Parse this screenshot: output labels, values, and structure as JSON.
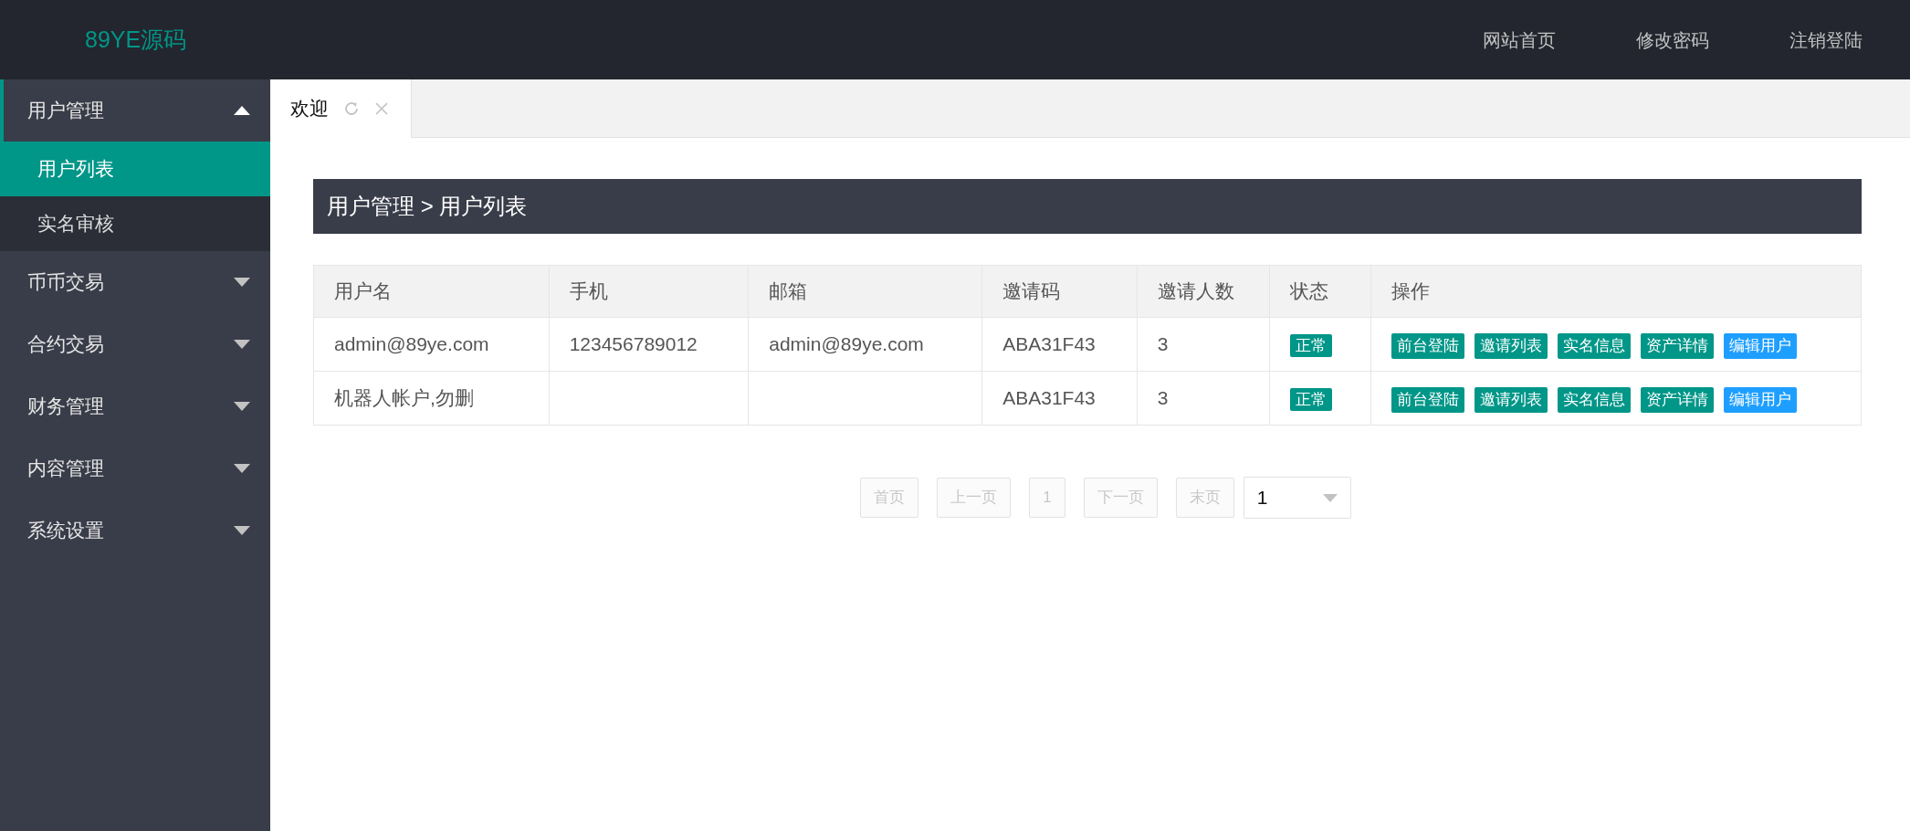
{
  "header": {
    "logo": "89YE源码",
    "links": [
      "网站首页",
      "修改密码",
      "注销登陆"
    ]
  },
  "sidebar": {
    "items": [
      {
        "label": "用户管理",
        "expanded": true,
        "children": [
          {
            "label": "用户列表",
            "selected": true
          },
          {
            "label": "实名审核",
            "selected": false
          }
        ]
      },
      {
        "label": "币币交易",
        "expanded": false
      },
      {
        "label": "合约交易",
        "expanded": false
      },
      {
        "label": "财务管理",
        "expanded": false
      },
      {
        "label": "内容管理",
        "expanded": false
      },
      {
        "label": "系统设置",
        "expanded": false
      }
    ]
  },
  "tabs": [
    {
      "label": "欢迎",
      "selected": true
    }
  ],
  "breadcrumb": "用户管理 > 用户列表",
  "table": {
    "columns": [
      "用户名",
      "手机",
      "邮箱",
      "邀请码",
      "邀请人数",
      "状态",
      "操作"
    ],
    "rows": [
      {
        "username": "admin@89ye.com",
        "phone": "123456789012",
        "email": "admin@89ye.com",
        "invite_code": "ABA31F43",
        "invites": "3",
        "status": "正常",
        "actions": [
          {
            "label": "前台登陆",
            "kind": "normal"
          },
          {
            "label": "邀请列表",
            "kind": "normal"
          },
          {
            "label": "实名信息",
            "kind": "normal"
          },
          {
            "label": "资产详情",
            "kind": "normal"
          },
          {
            "label": "编辑用户",
            "kind": "primary"
          }
        ]
      },
      {
        "username": "机器人帐户,勿删",
        "phone": "",
        "email": "",
        "invite_code": "ABA31F43",
        "invites": "3",
        "status": "正常",
        "actions": [
          {
            "label": "前台登陆",
            "kind": "normal"
          },
          {
            "label": "邀请列表",
            "kind": "normal"
          },
          {
            "label": "实名信息",
            "kind": "normal"
          },
          {
            "label": "资产详情",
            "kind": "normal"
          },
          {
            "label": "编辑用户",
            "kind": "primary"
          }
        ]
      }
    ]
  },
  "pagination": {
    "buttons": [
      {
        "label": "首页",
        "disabled": true
      },
      {
        "label": "上一页",
        "disabled": true
      },
      {
        "label": "1",
        "disabled": true
      },
      {
        "label": "下一页",
        "disabled": true
      },
      {
        "label": "末页",
        "disabled": true
      }
    ],
    "page_select": "1"
  }
}
